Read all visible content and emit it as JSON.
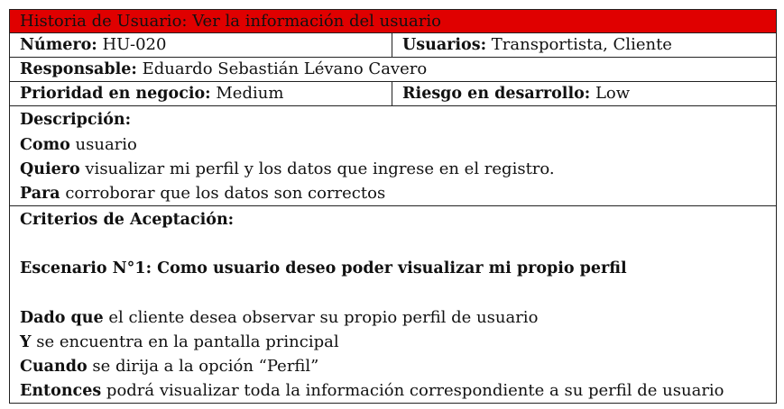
{
  "story": {
    "title_label": "Historia de Usuario:",
    "title_value": "Ver la información del usuario",
    "number_label": "Número:",
    "number_value": "HU-020",
    "users_label": "Usuarios:",
    "users_value": "Transportista, Cliente",
    "responsible_label": "Responsable:",
    "responsible_value": "Eduardo Sebastián Lévano Cavero",
    "priority_label": "Prioridad en negocio:",
    "priority_value": "Medium",
    "risk_label": "Riesgo en desarrollo:",
    "risk_value": "Low",
    "description": {
      "heading": "Descripción:",
      "como_label": "Como",
      "como_value": "usuario",
      "quiero_label": "Quiero",
      "quiero_value": "visualizar mi perfil y los datos que ingrese en el registro.",
      "para_label": "Para",
      "para_value": "corroborar que los datos son correctos"
    },
    "criteria": {
      "heading": "Criterios de Aceptación:",
      "scenario": "Escenario N°1: Como usuario deseo poder visualizar mi propio perfil",
      "dado_label": "Dado que",
      "dado_value": "el cliente desea observar su propio perfil de usuario",
      "y_label": "Y",
      "y_value": "se encuentra en la pantalla principal",
      "cuando_label": "Cuando",
      "cuando_value": "se dirija a la opción “Perfil”",
      "entonces_label": "Entonces",
      "entonces_value": "podrá visualizar toda la información correspondiente a su perfil de usuario"
    }
  }
}
